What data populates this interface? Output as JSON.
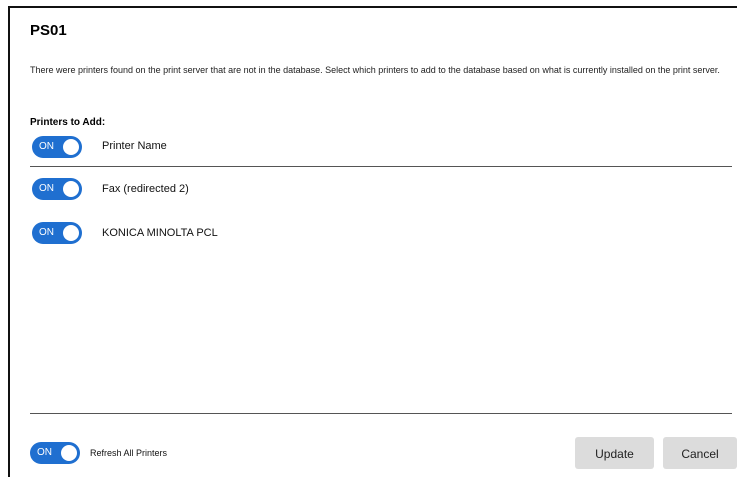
{
  "dialog": {
    "title": "PS01",
    "description": "There were printers found on the print server that are not in the database. Select which printers to add to the database based on what is currently installed on the print server.",
    "section_label": "Printers to Add:"
  },
  "toggle_on_text": "ON",
  "header_row": {
    "label": "Printer Name",
    "state": "ON"
  },
  "printers": [
    {
      "name": "Fax (redirected 2)",
      "state": "ON"
    },
    {
      "name": "KONICA MINOLTA PCL",
      "state": "ON"
    }
  ],
  "footer": {
    "refresh_label": "Refresh All Printers",
    "refresh_state": "ON",
    "update_label": "Update",
    "cancel_label": "Cancel"
  },
  "colors": {
    "toggle_on": "#1f6fd0",
    "button_bg": "#dcdcdc"
  }
}
